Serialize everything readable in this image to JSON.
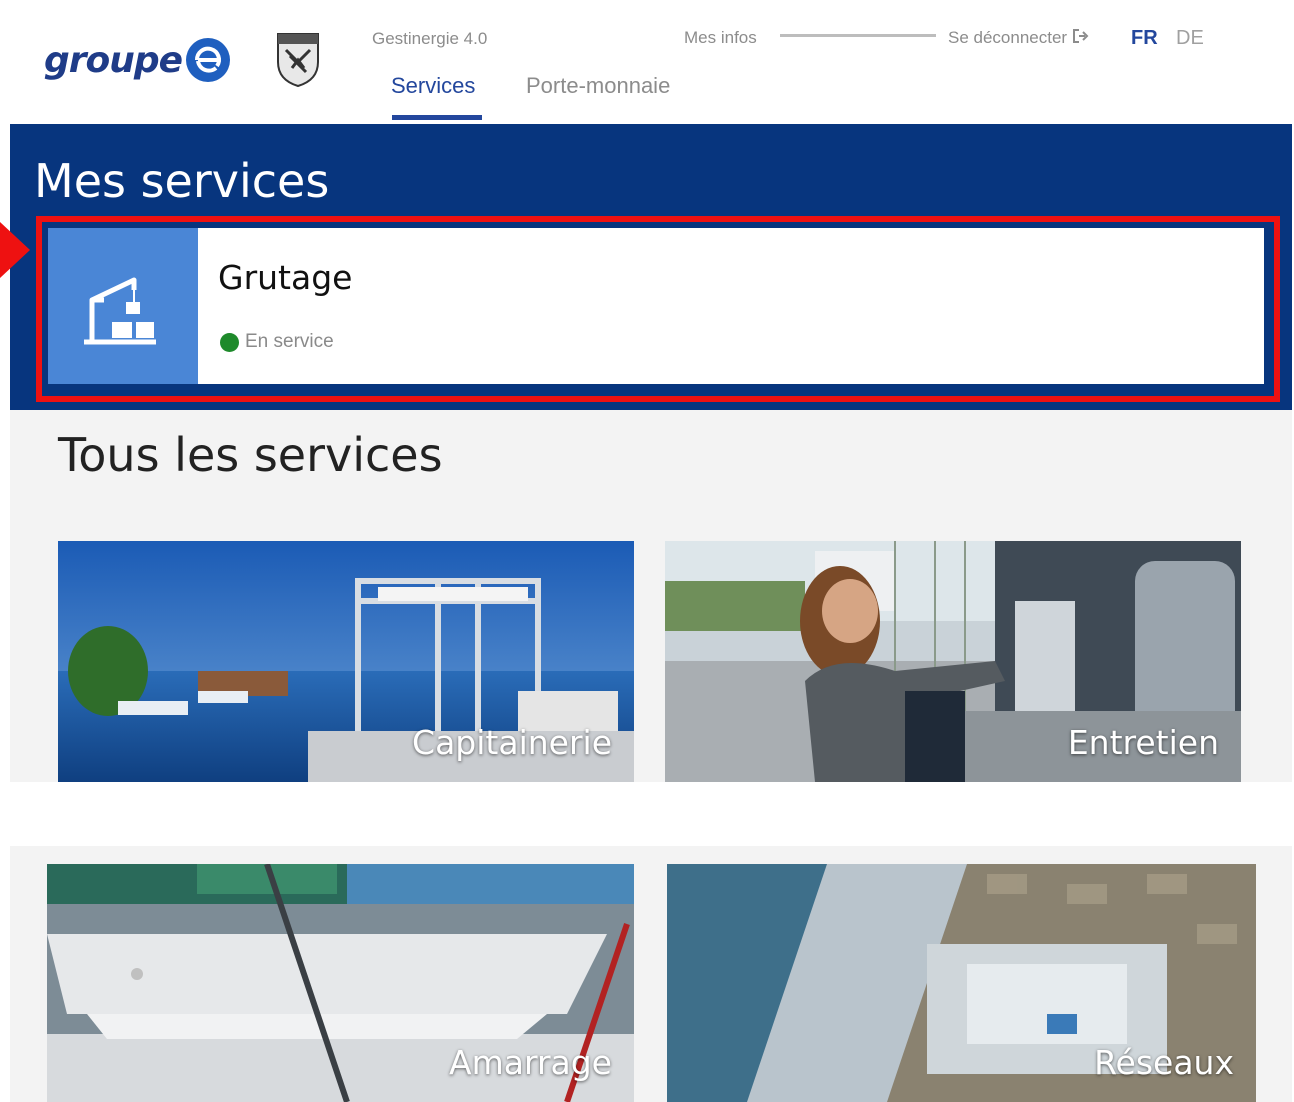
{
  "header": {
    "brand": "groupe",
    "app_name": "Gestinergie 4.0",
    "tabs": [
      {
        "label": "Services",
        "active": true
      },
      {
        "label": "Porte-monnaie",
        "active": false
      }
    ],
    "user_menu_label": "Mes infos",
    "logout_label": "Se déconnecter",
    "languages": [
      {
        "code": "FR",
        "active": true
      },
      {
        "code": "DE",
        "active": false
      }
    ]
  },
  "my_services": {
    "title": "Mes services",
    "items": [
      {
        "name": "Grutage",
        "status": "En service",
        "status_color": "#1e8a2b",
        "icon": "crane-icon"
      }
    ]
  },
  "all_services": {
    "title": "Tous les services",
    "tiles": [
      {
        "label": "Capitainerie",
        "image": "harbor-crane-photo"
      },
      {
        "label": "Entretien",
        "image": "woman-at-terminal-photo"
      },
      {
        "label": "Amarrage",
        "image": "sailboats-photo"
      },
      {
        "label": "Réseaux",
        "image": "power-box-photo"
      }
    ]
  },
  "colors": {
    "primary_blue": "#07357e",
    "accent_blue": "#23479d",
    "icon_box_blue": "#4a86d6",
    "highlight_red": "#ee1111"
  }
}
